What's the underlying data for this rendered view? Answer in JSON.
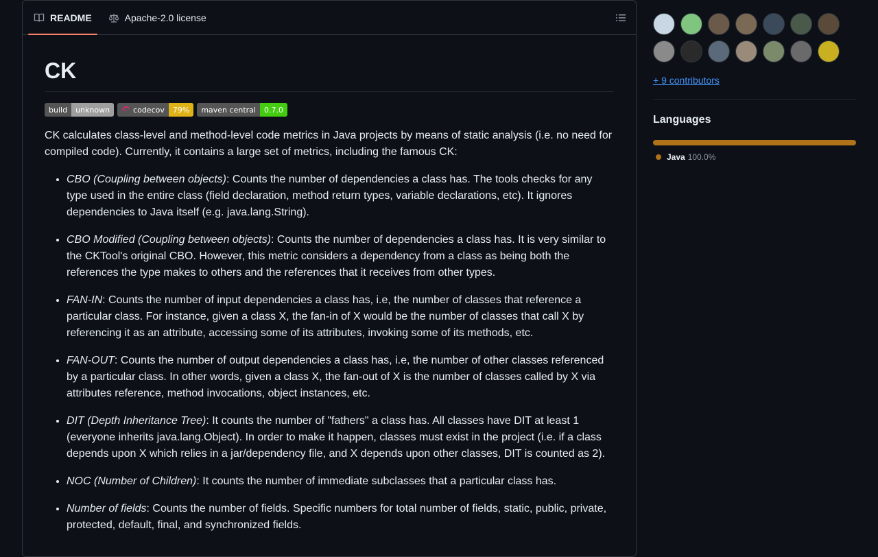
{
  "tabs": [
    {
      "label": "README",
      "icon": "book-icon",
      "active": true
    },
    {
      "label": "Apache-2.0 license",
      "icon": "law-icon",
      "active": false
    }
  ],
  "readme": {
    "title": "CK",
    "badges": [
      {
        "left": "build",
        "right": "unknown",
        "color": "#9f9f9f"
      },
      {
        "left": "codecov",
        "right": "79%",
        "color": "#dfb317",
        "icon": "codecov-icon"
      },
      {
        "left": "maven central",
        "right": "0.7.0",
        "color": "#4c1"
      }
    ],
    "intro": "CK calculates class-level and method-level code metrics in Java projects by means of static analysis (i.e. no need for compiled code). Currently, it contains a large set of metrics, including the famous CK:",
    "metrics": [
      {
        "term": "CBO (Coupling between objects)",
        "desc": ": Counts the number of dependencies a class has. The tools checks for any type used in the entire class (field declaration, method return types, variable declarations, etc). It ignores dependencies to Java itself (e.g. java.lang.String)."
      },
      {
        "term": "CBO Modified (Coupling between objects)",
        "desc": ": Counts the number of dependencies a class has. It is very similar to the CKTool's original CBO. However, this metric considers a dependency from a class as being both the references the type makes to others and the references that it receives from other types."
      },
      {
        "term": "FAN-IN",
        "desc": ": Counts the number of input dependencies a class has, i.e, the number of classes that reference a particular class. For instance, given a class X, the fan-in of X would be the number of classes that call X by referencing it as an attribute, accessing some of its attributes, invoking some of its methods, etc."
      },
      {
        "term": "FAN-OUT",
        "desc": ": Counts the number of output dependencies a class has, i.e, the number of other classes referenced by a particular class. In other words, given a class X, the fan-out of X is the number of classes called by X via attributes reference, method invocations, object instances, etc."
      },
      {
        "term": "DIT (Depth Inheritance Tree)",
        "desc": ": It counts the number of \"fathers\" a class has. All classes have DIT at least 1 (everyone inherits java.lang.Object). In order to make it happen, classes must exist in the project (i.e. if a class depends upon X which relies in a jar/dependency file, and X depends upon other classes, DIT is counted as 2)."
      },
      {
        "term": "NOC (Number of Children)",
        "desc": ": It counts the number of immediate subclasses that a particular class has."
      },
      {
        "term": "Number of fields",
        "desc": ": Counts the number of fields. Specific numbers for total number of fields, static, public, private, protected, default, final, and synchronized fields."
      }
    ]
  },
  "sidebar": {
    "avatar_colors": [
      "#c9d6e3",
      "#7fc47f",
      "#6b5a4a",
      "#7a6a55",
      "#3a4a5a",
      "#4a5a4a",
      "#5a4a3a",
      "#8a8a8a",
      "#2a2a2a",
      "#5a6a7a",
      "#9a8a7a",
      "#7a8a6a",
      "#6a6a6a",
      "#c8b020"
    ],
    "contributors_link": "+ 9 contributors",
    "languages_title": "Languages",
    "languages": [
      {
        "name": "Java",
        "percent": "100.0%",
        "color": "#b07219",
        "share": 1.0
      }
    ]
  }
}
